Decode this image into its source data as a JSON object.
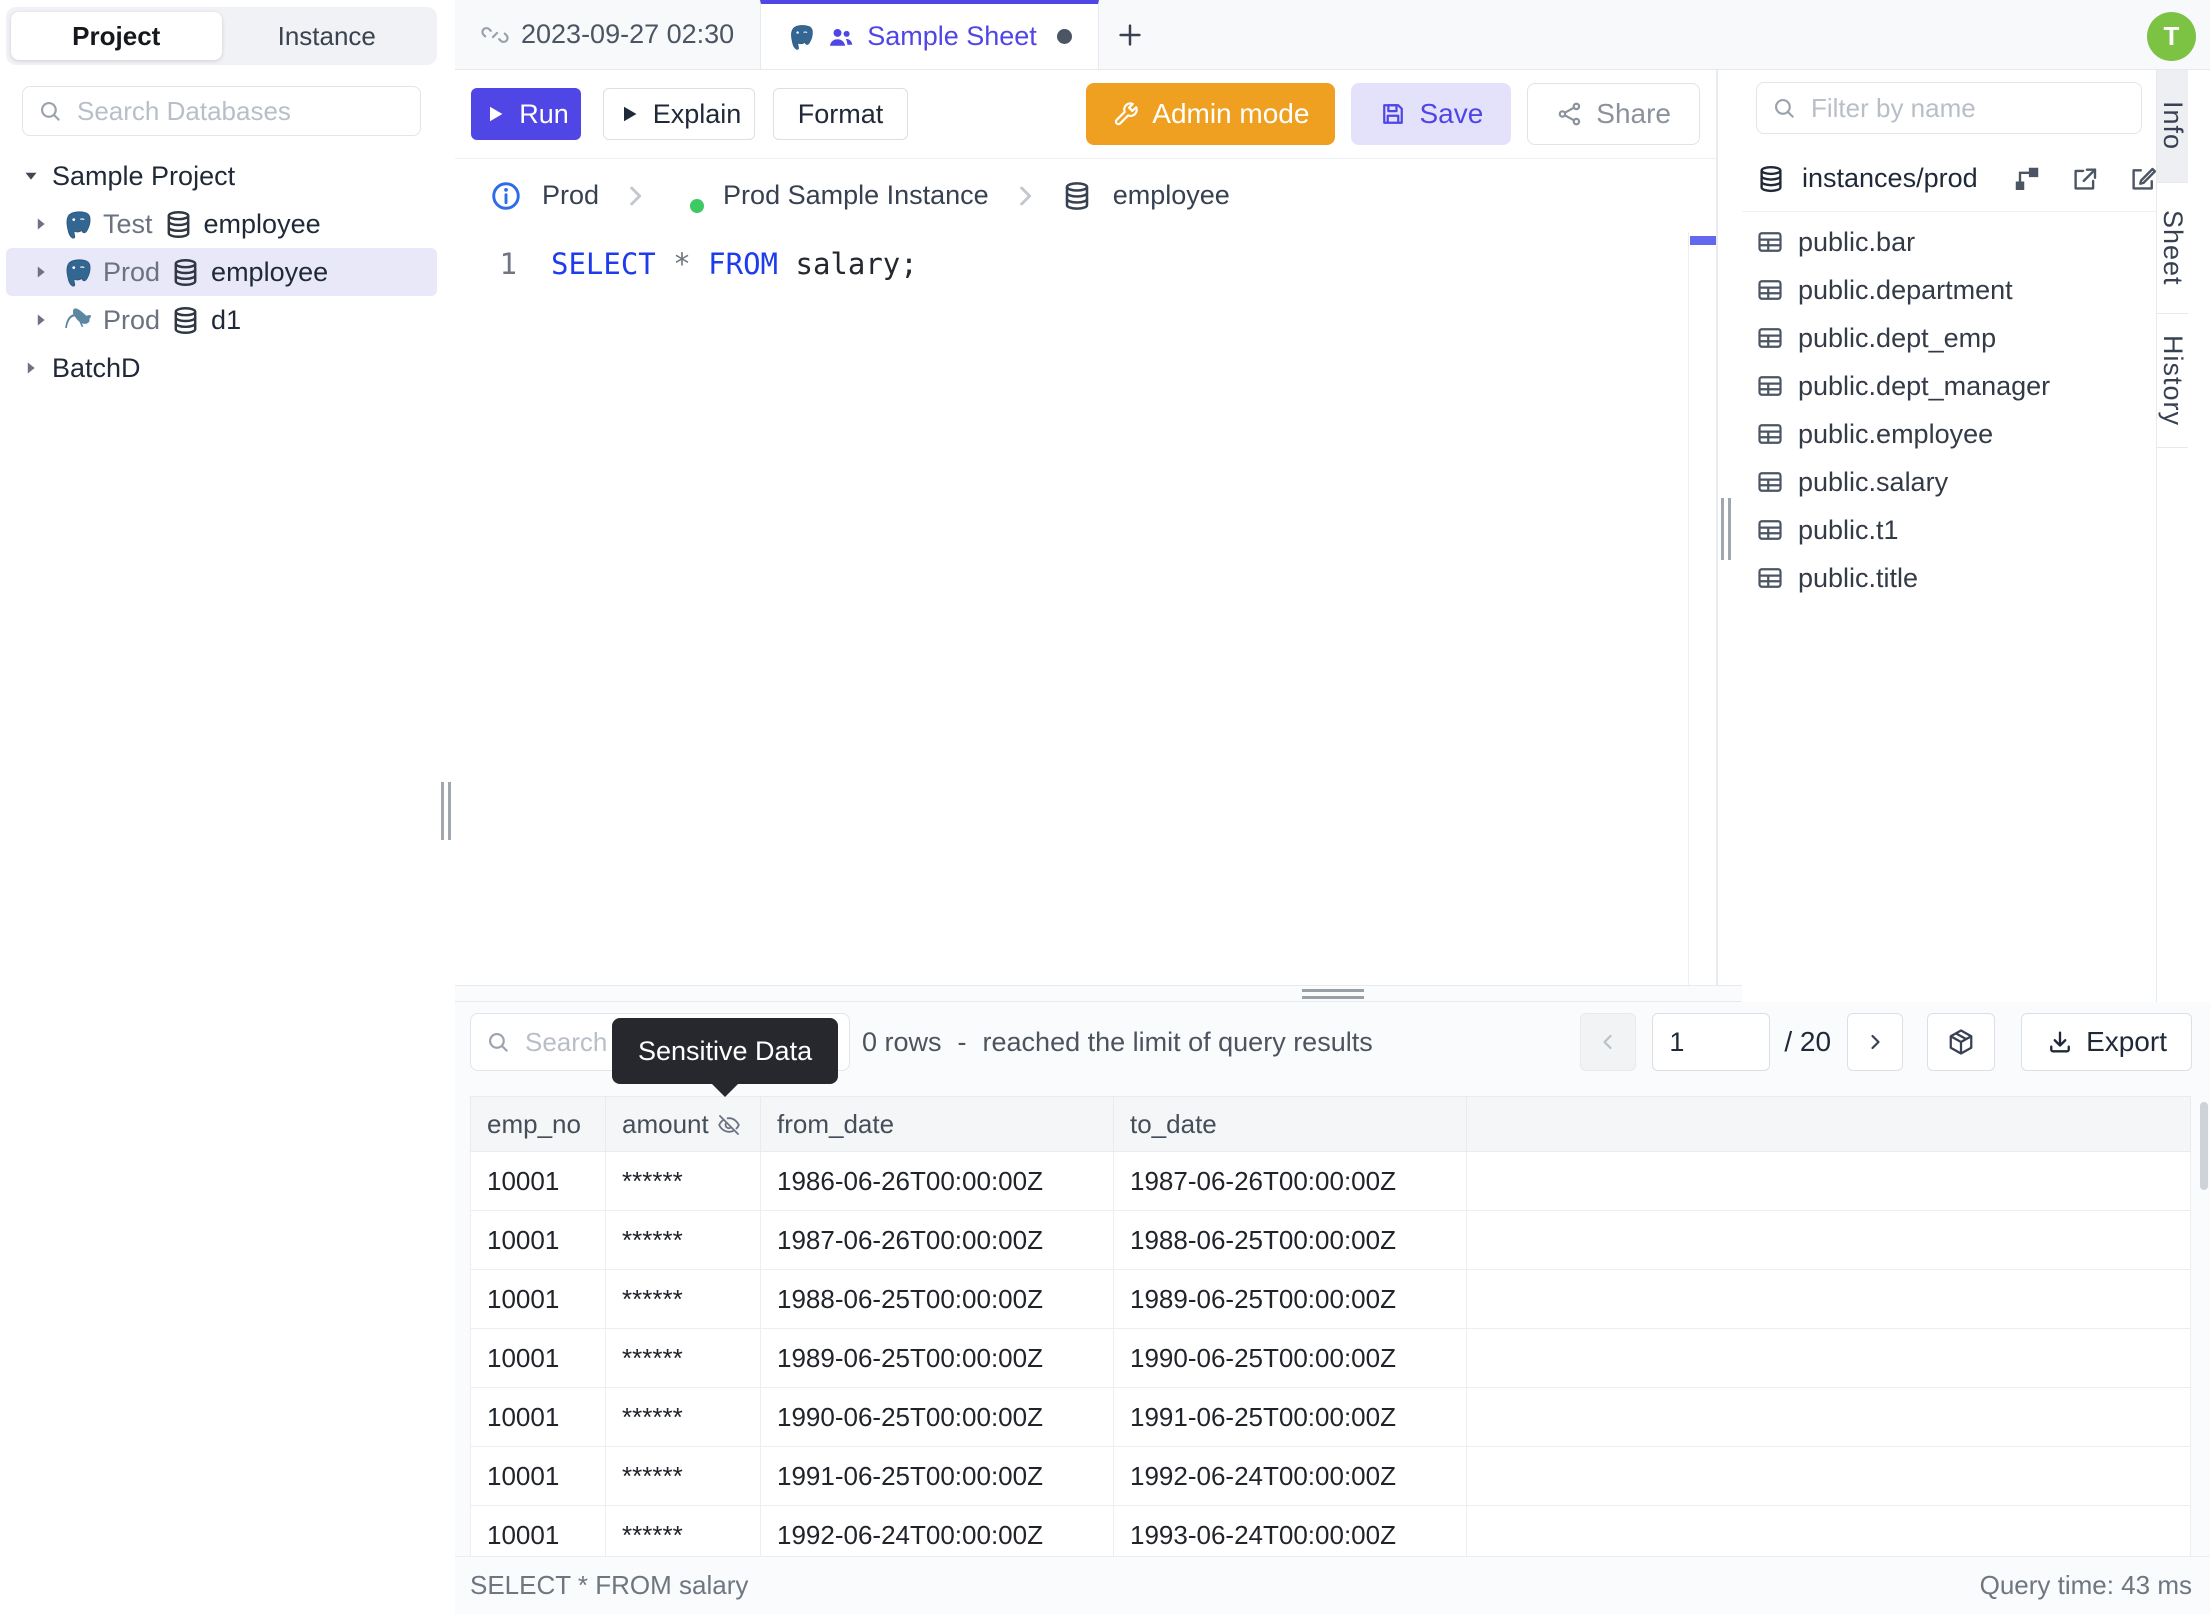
{
  "left_sidebar": {
    "tabs": [
      {
        "label": "Project",
        "active": true
      },
      {
        "label": "Instance",
        "active": false
      }
    ],
    "search_placeholder": "Search Databases",
    "tree": [
      {
        "caret": "down",
        "indent": 0,
        "selected": false,
        "parts": [
          {
            "text": "Sample Project",
            "style": "root"
          }
        ]
      },
      {
        "caret": "right",
        "indent": 1,
        "selected": false,
        "parts": [
          {
            "icon": "postgres-icon"
          },
          {
            "text": "Test",
            "style": "muted"
          },
          {
            "icon": "database-icon"
          },
          {
            "text": "employee",
            "style": "name"
          }
        ]
      },
      {
        "caret": "right",
        "indent": 1,
        "selected": true,
        "parts": [
          {
            "icon": "postgres-icon"
          },
          {
            "text": "Prod",
            "style": "muted"
          },
          {
            "icon": "database-icon"
          },
          {
            "text": "employee",
            "style": "name"
          }
        ]
      },
      {
        "caret": "right",
        "indent": 1,
        "selected": false,
        "parts": [
          {
            "icon": "mysql-icon"
          },
          {
            "text": "Prod",
            "style": "muted"
          },
          {
            "icon": "database-icon"
          },
          {
            "text": "d1",
            "style": "name"
          }
        ]
      },
      {
        "caret": "right",
        "indent": 0,
        "selected": false,
        "parts": [
          {
            "text": "BatchD",
            "style": "root"
          }
        ]
      }
    ]
  },
  "tab_bar": {
    "tab1": {
      "label": "2023-09-27 02:30",
      "icon": "unlink-icon"
    },
    "tab2": {
      "label": "Sample Sheet",
      "icons": [
        "postgres-icon",
        "people-icon"
      ],
      "unsaved_dot": true
    },
    "add_button": "+"
  },
  "toolbar": {
    "run_label": "Run",
    "explain_label": "Explain",
    "format_label": "Format",
    "admin_mode_label": "Admin mode",
    "save_label": "Save",
    "share_label": "Share"
  },
  "breadcrumb": {
    "environment": "Prod",
    "instance": "Prod Sample Instance",
    "database": "employee"
  },
  "editor": {
    "line_number": "1",
    "tokens": [
      {
        "text": "SELECT",
        "type": "keyword"
      },
      {
        "text": " ",
        "type": "plain"
      },
      {
        "text": "*",
        "type": "operator"
      },
      {
        "text": " ",
        "type": "plain"
      },
      {
        "text": "FROM",
        "type": "keyword"
      },
      {
        "text": " ",
        "type": "plain"
      },
      {
        "text": "salary;",
        "type": "plain"
      }
    ]
  },
  "right_sidebar": {
    "filter_placeholder": "Filter by name",
    "connection": "instances/prod",
    "action_icons": [
      "diagram-icon",
      "external-link-icon",
      "edit-icon"
    ],
    "tables": [
      "public.bar",
      "public.department",
      "public.dept_emp",
      "public.dept_manager",
      "public.employee",
      "public.salary",
      "public.t1",
      "public.title"
    ]
  },
  "side_tabs": {
    "info": "Info",
    "sheet": "Sheet",
    "history": "History"
  },
  "avatar": {
    "initial": "T"
  },
  "results": {
    "search_placeholder": "Search",
    "tooltip": "Sensitive Data",
    "rows_count": "0 rows",
    "separator": "-",
    "limit_notice": "reached the limit of query results",
    "page_value": "1",
    "page_total": "/ 20",
    "export_label": "Export",
    "table": {
      "columns": [
        "emp_no",
        "amount",
        "from_date",
        "to_date"
      ],
      "masked_column_index": 1,
      "rows": [
        [
          "10001",
          "******",
          "1986-06-26T00:00:00Z",
          "1987-06-26T00:00:00Z"
        ],
        [
          "10001",
          "******",
          "1987-06-26T00:00:00Z",
          "1988-06-25T00:00:00Z"
        ],
        [
          "10001",
          "******",
          "1988-06-25T00:00:00Z",
          "1989-06-25T00:00:00Z"
        ],
        [
          "10001",
          "******",
          "1989-06-25T00:00:00Z",
          "1990-06-25T00:00:00Z"
        ],
        [
          "10001",
          "******",
          "1990-06-25T00:00:00Z",
          "1991-06-25T00:00:00Z"
        ],
        [
          "10001",
          "******",
          "1991-06-25T00:00:00Z",
          "1992-06-24T00:00:00Z"
        ],
        [
          "10001",
          "******",
          "1992-06-24T00:00:00Z",
          "1993-06-24T00:00:00Z"
        ]
      ]
    },
    "status_query": "SELECT * FROM salary",
    "status_time": "Query time: 43 ms"
  },
  "colors": {
    "accent": "#4f46e5",
    "admin_orange": "#f0a020",
    "avatar_green": "#7cc243",
    "keyword_blue": "#1e3cec",
    "selection_lavender": "#e9e8f8",
    "tooltip_dark": "#26282e"
  }
}
